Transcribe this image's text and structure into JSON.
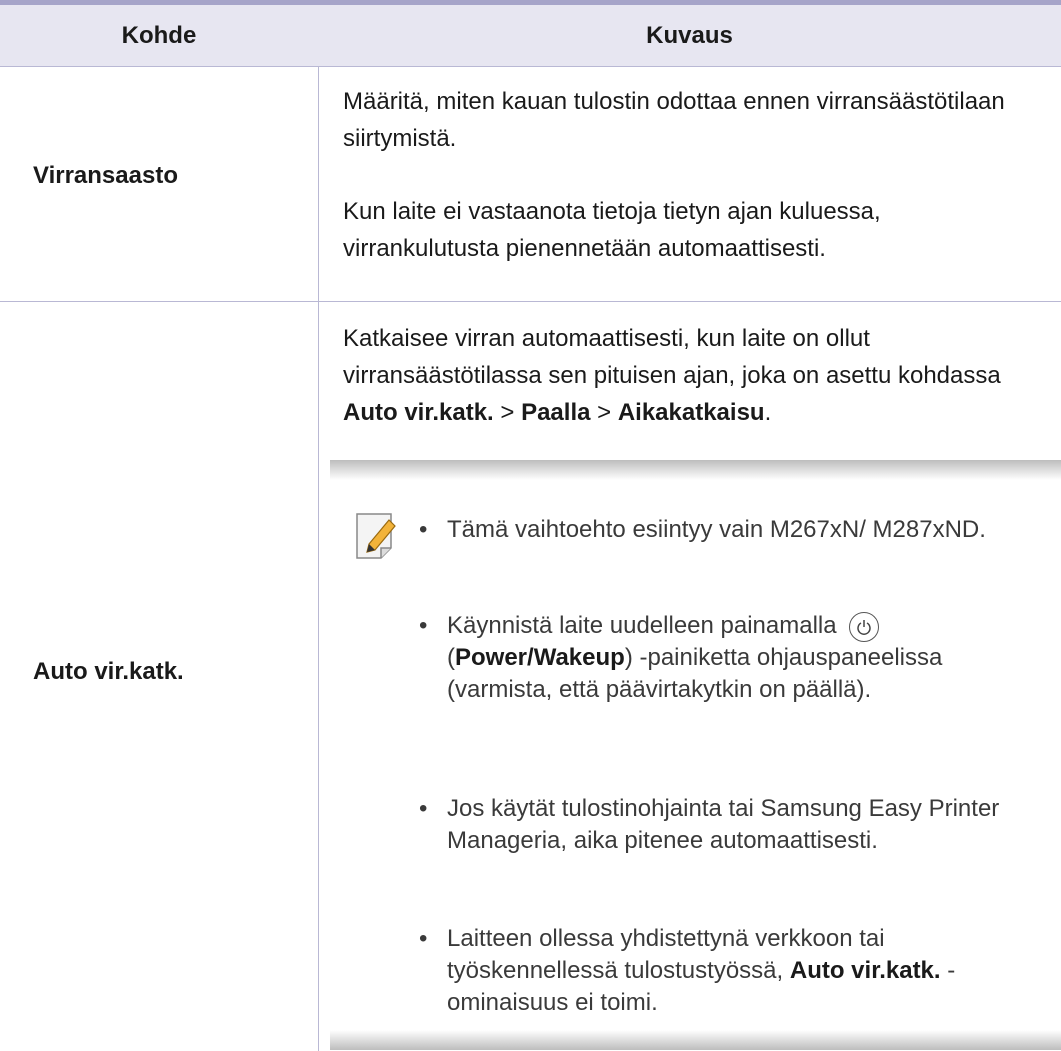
{
  "header": {
    "col1": "Kohde",
    "col2": "Kuvaus"
  },
  "rows": [
    {
      "item": "Virransaasto",
      "desc1": "Määritä, miten kauan tulostin odottaa ennen virransäästötilaan siirtymistä.",
      "desc2": "Kun laite ei vastaanota tietoja tietyn ajan kuluessa, virrankulutusta pienennetään automaattisesti."
    },
    {
      "item": "Auto vir.katk.",
      "desc_pre": "Katkaisee virran automaattisesti, kun laite on ollut virransäästötilassa sen pituisen ajan, joka on asettu kohdassa",
      "path1": "Auto vir.katk.",
      "sep1": ">",
      "path2": "Paalla",
      "sep2": ">",
      "path3": "Aikakatkaisu",
      "path_end": ".",
      "note": {
        "icon": "note-pencil-icon",
        "bullet1": "Tämä vaihtoehto esiintyy vain M267xN/ M287xND.",
        "bullet2_pre": "Käynnistä laite uudelleen painamalla",
        "bullet2_icon": "power-icon",
        "bullet2_open": "(",
        "bullet2_bold": "Power/Wakeup",
        "bullet2_post": ") -painiketta ohjauspaneelissa (varmista, että päävirtakytkin on päällä).",
        "bullet3": "Jos käytät tulostinohjainta tai Samsung Easy Printer Manageria, aika pitenee automaattisesti.",
        "bullet4_pre": "Laitteen ollessa yhdistettynä verkkoon tai työskennellessä tulostustyössä,",
        "bullet4_bold": "Auto vir.katk.",
        "bullet4_post": "-ominaisuus ei toimi."
      }
    }
  ]
}
